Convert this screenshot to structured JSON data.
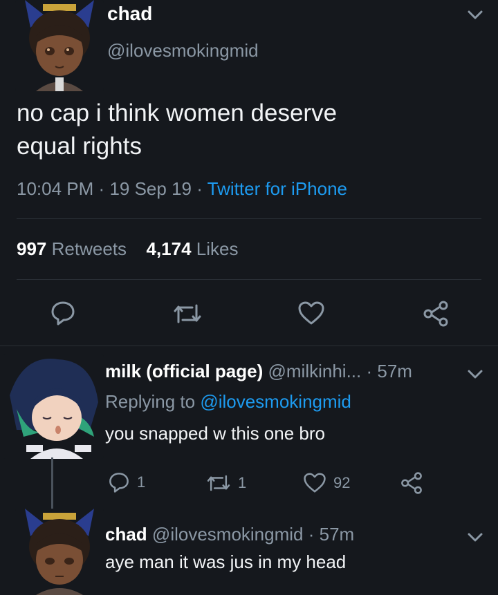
{
  "main_tweet": {
    "display_name": "chad",
    "handle": "@ilovesmokingmid",
    "text_line1": "no cap i think women deserve",
    "text_line2": "equal rights",
    "time": "10:04 PM",
    "sep1": "·",
    "date": "19 Sep 19",
    "sep2": "·",
    "client": "Twitter for iPhone",
    "retweets_count": "997",
    "retweets_label": "Retweets",
    "likes_count": "4,174",
    "likes_label": "Likes"
  },
  "reply1": {
    "display_name": "milk (official page)",
    "handle": "@milkinhi...",
    "time": "· 57m",
    "replying_prefix": "Replying to",
    "replying_to": "@ilovesmokingmid",
    "text": "you snapped w this one bro",
    "reply_count": "1",
    "retweet_count": "1",
    "like_count": "92"
  },
  "reply2": {
    "display_name": "chad",
    "handle": "@ilovesmokingmid",
    "time": "· 57m",
    "text": "aye man it was jus in my head"
  },
  "colors": {
    "background": "#15181d",
    "accent": "#1d9bf0",
    "muted": "#8b98a5"
  },
  "icons": [
    "reply-icon",
    "retweet-icon",
    "like-icon",
    "share-icon",
    "chevron-down-icon"
  ]
}
